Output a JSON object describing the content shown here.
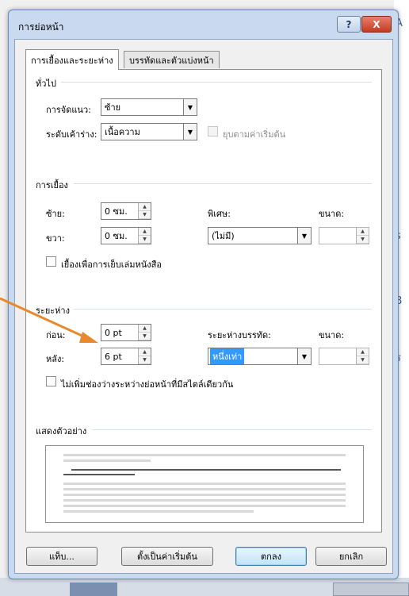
{
  "dialog": {
    "title": "การย่อหน้า",
    "help_label": "?",
    "close_label": "X"
  },
  "tabs": [
    {
      "label": "การเยื้องและระยะห่าง",
      "active": true
    },
    {
      "label": "บรรทัดและตัวแบ่งหน้า",
      "active": false
    }
  ],
  "general": {
    "heading": "ทั่วไป",
    "alignment_label": "การจัดแนว:",
    "alignment_value": "ซ้าย",
    "outline_label": "ระดับเค้าร่าง:",
    "outline_value": "เนื้อความ",
    "collapsed_label": "ยุบตามค่าเริ่มต้น"
  },
  "indentation": {
    "heading": "การเยื้อง",
    "left_label": "ซ้าย:",
    "left_value": "0 ซม.",
    "right_label": "ขวา:",
    "right_value": "0 ซม.",
    "special_label": "พิเศษ:",
    "special_value": "(ไม่มี)",
    "by_label": "ขนาด:",
    "by_value": "",
    "mirror_label": "เยื้องเพื่อการเย็บเล่มหนังสือ"
  },
  "spacing": {
    "heading": "ระยะห่าง",
    "before_label": "ก่อน:",
    "before_value": "0 pt",
    "after_label": "หลัง:",
    "after_value": "6 pt",
    "line_spacing_label": "ระยะห่างบรรทัด:",
    "line_spacing_value": "หนึ่งเท่า",
    "at_label": "ขนาด:",
    "at_value": "",
    "dont_add_label": "ไม่เพิ่มช่องว่างระหว่างย่อหน้าที่มีสไตล์เดียวกัน"
  },
  "preview": {
    "heading": "แสดงตัวอย่าง"
  },
  "buttons": {
    "tabs": "แท็บ...",
    "set_default": "ตั้งเป็นค่าเริ่มต้น",
    "ok": "ตกลง",
    "cancel": "ยกเลิก"
  },
  "colors": {
    "annotation_arrow": "#e8892e",
    "selection": "#3399ff",
    "close_button": "#c43b22"
  }
}
